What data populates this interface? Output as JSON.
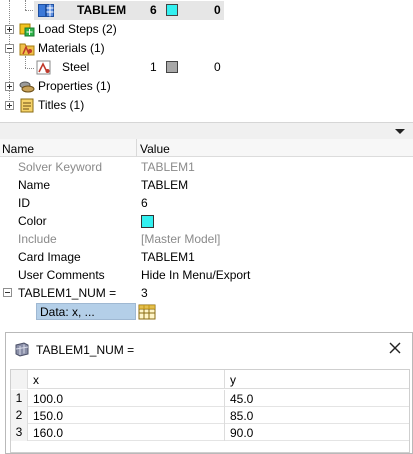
{
  "tree": {
    "tablem": {
      "label": "TABLEM",
      "id": "6",
      "count": "0",
      "color": "#33f0f0"
    },
    "load_steps": {
      "label": "Load Steps (2)"
    },
    "materials": {
      "label": "Materials (1)"
    },
    "steel": {
      "label": "Steel",
      "id": "1",
      "count": "0",
      "color": "#a8a8a8"
    },
    "properties": {
      "label": "Properties (1)"
    },
    "titles": {
      "label": "Titles (1)"
    }
  },
  "grid": {
    "headers": {
      "name": "Name",
      "value": "Value"
    },
    "rows": [
      {
        "name": "Solver Keyword",
        "value": "TABLEM1"
      },
      {
        "name": "Name",
        "value": "TABLEM"
      },
      {
        "name": "ID",
        "value": "6"
      },
      {
        "name": "Color",
        "value": ""
      },
      {
        "name": "Include",
        "value": "[Master Model]"
      },
      {
        "name": "Card Image",
        "value": "TABLEM1"
      },
      {
        "name": "User Comments",
        "value": "Hide In Menu/Export"
      },
      {
        "name": "TABLEM1_NUM =",
        "value": "3"
      }
    ],
    "data_label": "Data: x, ...",
    "color_value": "#33f0f0"
  },
  "dialog": {
    "title": "TABLEM1_NUM =",
    "columns": [
      "x",
      "y"
    ],
    "rows": [
      {
        "n": "1",
        "x": "100.0",
        "y": "45.0"
      },
      {
        "n": "2",
        "x": "150.0",
        "y": "85.0"
      },
      {
        "n": "3",
        "x": "160.0",
        "y": "90.0"
      }
    ]
  }
}
